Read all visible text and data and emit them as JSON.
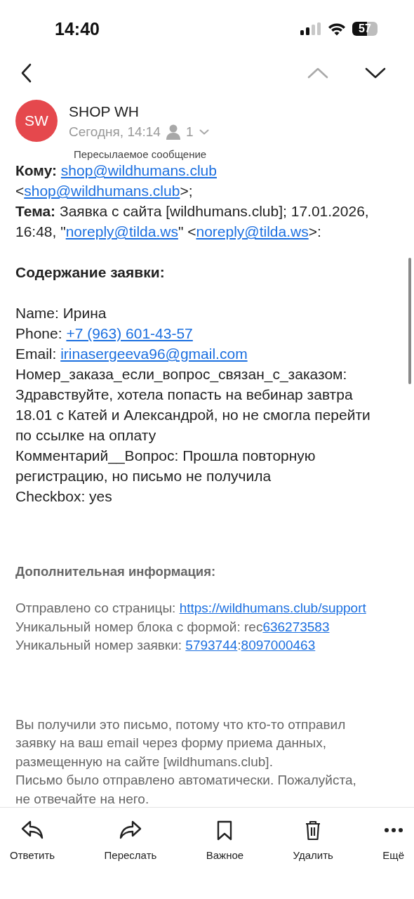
{
  "status_bar": {
    "time": "14:40",
    "battery": "57"
  },
  "navigation": {
    "previous": {
      "disabled": true
    },
    "next": {
      "disabled": false
    }
  },
  "message": {
    "avatar": "SW",
    "sender": "SHOP WH",
    "date": "Сегодня, 14:14",
    "recipients_count": "1"
  },
  "forwarded_label": "Пересылаемое сообщение",
  "body": [
    {
      "kind": "text",
      "parts": [
        {
          "kind": "bold",
          "text": "Кому: "
        },
        {
          "kind": "link",
          "text": "shop@wildhumans.club"
        },
        {
          "kind": "plain",
          "text": " <"
        },
        {
          "kind": "link",
          "text": "shop@wildhumans.club"
        },
        {
          "kind": "plain",
          "text": ">;"
        }
      ]
    },
    {
      "kind": "text",
      "parts": [
        {
          "kind": "bold",
          "text": "Тема: "
        },
        {
          "kind": "plain",
          "text": "Заявка с сайта [wildhumans.club]; 17.01.2026, 16:48, \""
        },
        {
          "kind": "link",
          "text": "noreply@tilda.ws"
        },
        {
          "kind": "plain",
          "text": "\" <"
        },
        {
          "kind": "link",
          "text": "noreply@tilda.ws"
        },
        {
          "kind": "plain",
          "text": ">:"
        }
      ]
    },
    {
      "kind": "blank"
    },
    {
      "kind": "text",
      "parts": [
        {
          "kind": "bold",
          "text": "Содержание заявки:"
        }
      ]
    },
    {
      "kind": "blank"
    },
    {
      "kind": "text",
      "parts": [
        {
          "kind": "plain",
          "text": "Name: Ирина"
        }
      ]
    },
    {
      "kind": "text",
      "parts": [
        {
          "kind": "plain",
          "text": "Phone: "
        },
        {
          "kind": "link",
          "text": "+7 (963) 601-43-57"
        }
      ]
    },
    {
      "kind": "text",
      "parts": [
        {
          "kind": "plain",
          "text": "Email: "
        },
        {
          "kind": "link",
          "text": "irinasergeeva96@gmail.com"
        }
      ]
    },
    {
      "kind": "text",
      "parts": [
        {
          "kind": "plain",
          "text": "Номер_заказа_если_вопрос_связан_с_заказом: Здравствуйте, хотела попасть на вебинар завтра 18.01 с Катей и Александрой, но не смогла перейти по ссылке на оплату"
        }
      ]
    },
    {
      "kind": "text",
      "parts": [
        {
          "kind": "plain",
          "text": "Комментарий__Вопрос: Прошла повторную регистрацию, но письмо не получила"
        }
      ]
    },
    {
      "kind": "text",
      "parts": [
        {
          "kind": "plain",
          "text": "Checkbox: yes"
        }
      ]
    }
  ],
  "extra_info": {
    "title": "Дополнительная информация:",
    "lines": [
      {
        "parts": [
          {
            "kind": "plain",
            "text": "Отправлено со страницы: "
          },
          {
            "kind": "link",
            "text": "https://wildhumans.club/support"
          }
        ]
      },
      {
        "parts": [
          {
            "kind": "plain",
            "text": "Уникальный номер блока с формой: rec"
          },
          {
            "kind": "link",
            "text": "636273583"
          }
        ]
      },
      {
        "parts": [
          {
            "kind": "plain",
            "text": "Уникальный номер заявки: "
          },
          {
            "kind": "link",
            "text": "5793744"
          },
          {
            "kind": "plain",
            "text": ":"
          },
          {
            "kind": "link",
            "text": "8097000463"
          }
        ]
      }
    ]
  },
  "footer": [
    "Вы получили это письмо, потому что кто-то отправил заявку на ваш email через форму приема данных, размещенную на сайте [wildhumans.club].",
    "Письмо было отправлено автоматически. Пожалуйста, не отвечайте на него."
  ],
  "toolbar": [
    {
      "kind": "reply",
      "label": "Ответить"
    },
    {
      "kind": "forward",
      "label": "Переслать"
    },
    {
      "kind": "bookmark",
      "label": "Важное"
    },
    {
      "kind": "delete",
      "label": "Удалить"
    },
    {
      "kind": "more",
      "label": "Ещё"
    }
  ]
}
